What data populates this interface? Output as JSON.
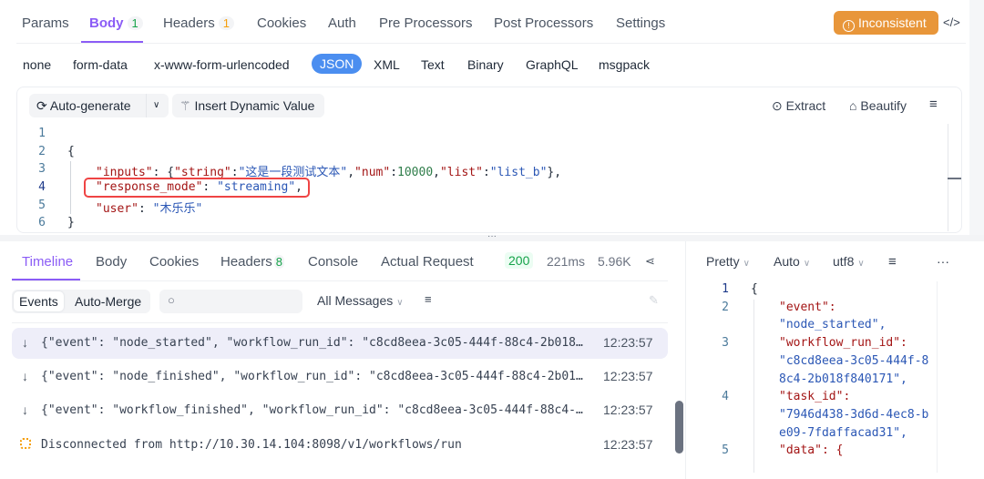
{
  "request_tabs": [
    {
      "label": "Params"
    },
    {
      "label": "Body",
      "badge": "1"
    },
    {
      "label": "Headers",
      "badge": "1"
    },
    {
      "label": "Cookies"
    },
    {
      "label": "Auth"
    },
    {
      "label": "Pre Processors"
    },
    {
      "label": "Post Processors"
    },
    {
      "label": "Settings"
    }
  ],
  "status_button": "Inconsistent",
  "body_types": [
    "none",
    "form-data",
    "x-www-form-urlencoded",
    "JSON",
    "XML",
    "Text",
    "Binary",
    "GraphQL",
    "msgpack"
  ],
  "editor_toolbar": {
    "auto_generate": "Auto-generate",
    "insert_dynamic": "Insert Dynamic Value",
    "extract": "Extract",
    "beautify": "Beautify"
  },
  "code_lines": [
    "1",
    "2",
    "3",
    "4",
    "5",
    "6"
  ],
  "code": {
    "l2": "{",
    "k_inputs": "\"inputs\"",
    "inputs_pre": ": {",
    "k_string": "\"string\"",
    "v_string": "\"这是一段测试文本\"",
    "k_num": "\"num\"",
    "v_num": "10000",
    "k_list": "\"list\"",
    "v_list": "\"list_b\"",
    "inputs_post": "},",
    "k_mode": "\"response_mode\"",
    "v_mode": "\"streaming\"",
    "k_user": "\"user\"",
    "v_user": "\"木乐乐\"",
    "l6": "}",
    "colon": ":",
    "comma": ","
  },
  "response_tabs": [
    {
      "label": "Timeline"
    },
    {
      "label": "Body"
    },
    {
      "label": "Cookies"
    },
    {
      "label": "Headers",
      "badge": "8"
    },
    {
      "label": "Console"
    },
    {
      "label": "Actual Request"
    }
  ],
  "response_meta": {
    "status": "200",
    "time": "221ms",
    "size": "5.96K"
  },
  "filters": {
    "events": "Events",
    "auto_merge": "Auto-Merge",
    "search_placeholder": "",
    "messages": "All Messages"
  },
  "events": [
    {
      "text": "{\"event\": \"node_started\", \"workflow_run_id\": \"c8cd8eea-3c05-444f-88c4-2b018…",
      "time": "12:23:57"
    },
    {
      "text": "{\"event\": \"node_finished\", \"workflow_run_id\": \"c8cd8eea-3c05-444f-88c4-2b01…",
      "time": "12:23:57"
    },
    {
      "text": "{\"event\": \"workflow_finished\", \"workflow_run_id\": \"c8cd8eea-3c05-444f-88c4-…",
      "time": "12:23:57"
    },
    {
      "text": "Disconnected from http://10.30.14.104:8098/v1/workflows/run",
      "time": "12:23:57"
    }
  ],
  "viewer": {
    "format": "Pretty",
    "mode": "Auto",
    "encoding": "utf8",
    "more": "···",
    "lines": [
      {
        "n": "1",
        "t": "{",
        "c": "p"
      },
      {
        "n": "2",
        "t": "\"event\":",
        "c": "k"
      },
      {
        "n": "",
        "t": "\"node_started\",",
        "c": "s"
      },
      {
        "n": "3",
        "t": "\"workflow_run_id\":",
        "c": "k"
      },
      {
        "n": "",
        "t": "\"c8cd8eea-3c05-444f-8",
        "c": "s"
      },
      {
        "n": "",
        "t": "8c4-2b018f840171\",",
        "c": "s"
      },
      {
        "n": "4",
        "t": "\"task_id\":",
        "c": "k"
      },
      {
        "n": "",
        "t": "\"7946d438-3d6d-4ec8-b",
        "c": "s"
      },
      {
        "n": "",
        "t": "e09-7fdaffacad31\",",
        "c": "s"
      },
      {
        "n": "5",
        "t": "\"data\": {",
        "c": "k"
      }
    ]
  },
  "colors": {
    "accent": "#8b5cf6",
    "json_btn": "#4b8ef0",
    "warning": "#e8963a",
    "highlight": "#ef4444"
  }
}
